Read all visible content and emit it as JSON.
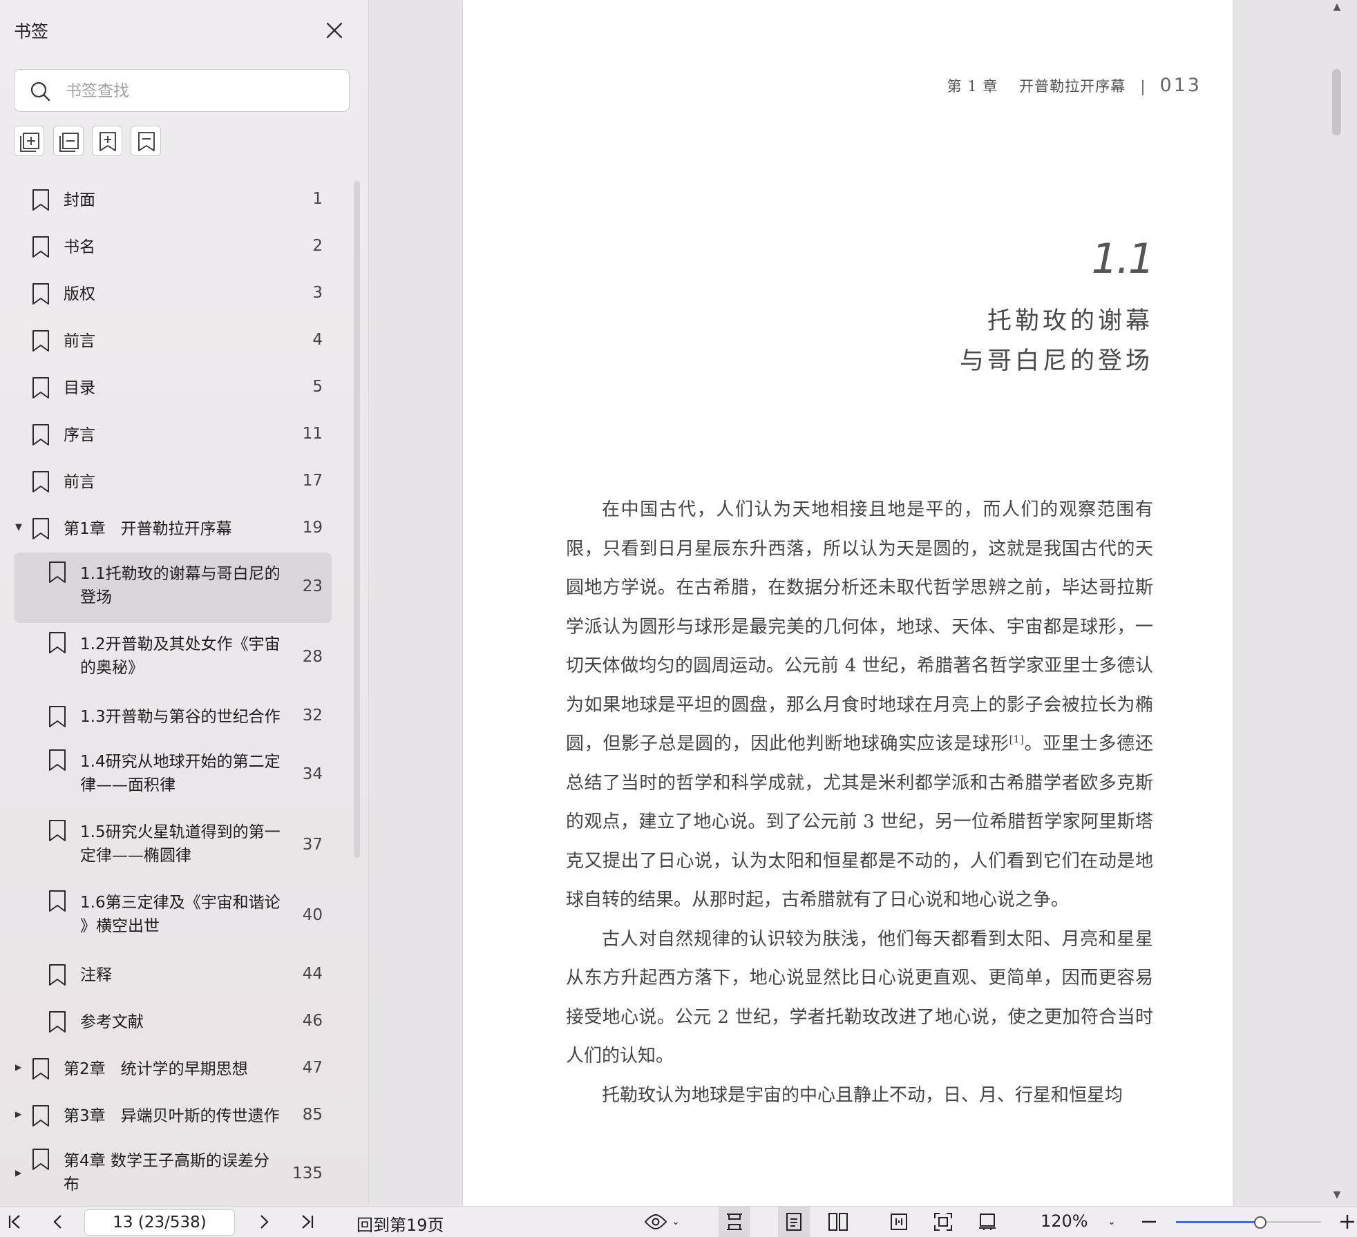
{
  "sidebar": {
    "title": "书签",
    "search_placeholder": "书签查找",
    "tools": [
      "expand-all-icon",
      "collapse-all-icon",
      "add-bookmark-icon",
      "bookmark-icon"
    ],
    "items": [
      {
        "label": "封面",
        "page": "1",
        "level": 0
      },
      {
        "label": "书名",
        "page": "2",
        "level": 0
      },
      {
        "label": "版权",
        "page": "3",
        "level": 0
      },
      {
        "label": "前言",
        "page": "4",
        "level": 0
      },
      {
        "label": "目录",
        "page": "5",
        "level": 0
      },
      {
        "label": "序言",
        "page": "11",
        "level": 0
      },
      {
        "label": "前言",
        "page": "17",
        "level": 0
      },
      {
        "label": "第1章   开普勒拉开序幕",
        "page": "19",
        "level": 0,
        "expanded": true
      },
      {
        "label": "1.1托勒玫的谢幕与哥白尼的登场",
        "page": "23",
        "level": 1,
        "active": true
      },
      {
        "label": "1.2开普勒及其处女作《宇宙的奥秘》",
        "page": "28",
        "level": 1
      },
      {
        "label": "1.3开普勒与第谷的世纪合作",
        "page": "32",
        "level": 1
      },
      {
        "label": "1.4研究从地球开始的第二定律——面积律",
        "page": "34",
        "level": 1
      },
      {
        "label": "1.5研究火星轨道得到的第一定律——椭圆律",
        "page": "37",
        "level": 1
      },
      {
        "label": "1.6第三定律及《宇宙和谐论》横空出世",
        "page": "40",
        "level": 1
      },
      {
        "label": "注释",
        "page": "44",
        "level": 1
      },
      {
        "label": "参考文献",
        "page": "46",
        "level": 1
      },
      {
        "label": "第2章   统计学的早期思想",
        "page": "47",
        "level": 0,
        "expanded": false
      },
      {
        "label": "第3章   异端贝叶斯的传世遗作",
        "page": "85",
        "level": 0,
        "expanded": false
      },
      {
        "label": "第4章   数学王子高斯的误差分布",
        "page": "135",
        "level": 0,
        "expanded": false
      }
    ]
  },
  "document": {
    "running_head": {
      "chapter": "第 1 章",
      "title": "开普勒拉开序幕",
      "page": "013"
    },
    "section_number": "1.1",
    "section_title_line1": "托勒玫的谢幕",
    "section_title_line2": "与哥白尼的登场",
    "p1": "在中国古代，人们认为天地相接且地是平的，而人们的观察范围有限，只看到日月星辰东升西落，所以认为天是圆的，这就是我国古代的天圆地方学说。在古希腊，在数据分析还未取代哲学思辨之前，毕达哥拉斯学派认为圆形与球形是最完美的几何体，地球、天体、宇宙都是球形，一切天体做均匀的圆周运动。公元前 4 世纪，希腊著名哲学家亚里士多德认为如果地球是平坦的圆盘，那么月食时地球在月亮上的影子会被拉长为椭圆，但影子总是圆的，因此他判断地球确实应该是球形",
    "p1_ref": "[1]",
    "p1_rest": "。亚里士多德还总结了当时的哲学和科学成就，尤其是米利都学派和古希腊学者欧多克斯的观点，建立了地心说。到了公元前 3 世纪，另一位希腊哲学家阿里斯塔克又提出了日心说，认为太阳和恒星都是不动的，人们看到它们在动是地球自转的结果。从那时起，古希腊就有了日心说和地心说之争。",
    "p2": "古人对自然规律的认识较为肤浅，他们每天都看到太阳、月亮和星星从东方升起西方落下，地心说显然比日心说更直观、更简单，因而更容易接受地心说。公元 2 世纪，学者托勒玫改进了地心说，使之更加符合当时人们的认知。",
    "p3": "托勒玫认为地球是宇宙的中心且静止不动，日、月、行星和恒星均"
  },
  "statusbar": {
    "page_value": "13 (23/538)",
    "back_link": "回到第19页",
    "zoom": "120%",
    "zoom_fraction": 0.58
  }
}
